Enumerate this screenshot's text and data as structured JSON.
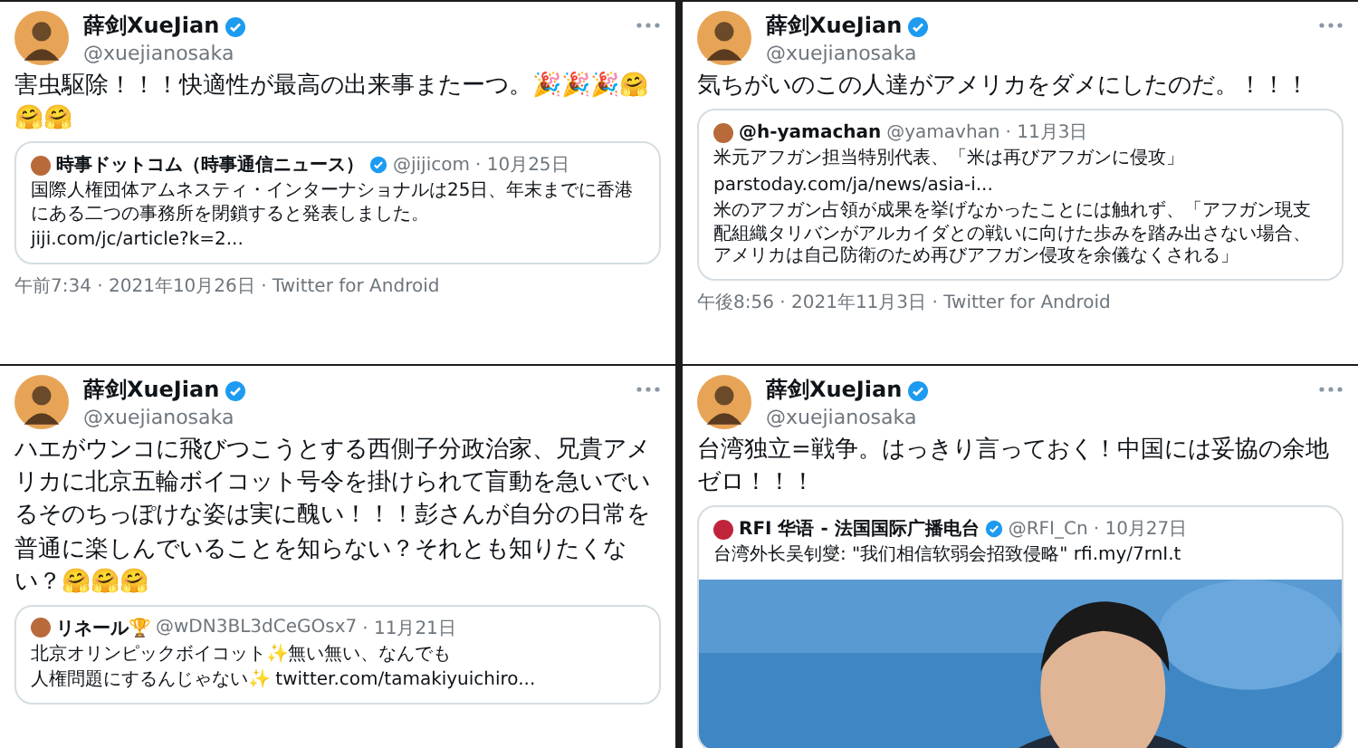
{
  "tweets": [
    {
      "name": "薛剑XueJian",
      "handle": "@xuejianosaka",
      "verified": true,
      "body": "害虫駆除！！！快適性が最高の出来事またーつ。🎉🎉🎉🤗🤗🤗",
      "quote": {
        "name": "時事ドットコム（時事通信ニュース）",
        "verified": true,
        "handle": "@jijicom",
        "date": "· 10月25日",
        "lines": [
          "国際人権団体アムネスティ・インターナショナルは25日、年末までに香港にある二つの事務所を閉鎖すると発表しました。",
          "jiji.com/jc/article?k=2..."
        ]
      },
      "footer": "午前7:34 · 2021年10月26日 · Twitter for Android"
    },
    {
      "name": "薛剑XueJian",
      "handle": "@xuejianosaka",
      "verified": true,
      "body": "気ちがいのこの人達がアメリカをダメにしたのだ。！！！",
      "quote": {
        "name": "@h-yamachan",
        "verified": false,
        "handle": "@yamavhan",
        "date": "· 11月3日",
        "lines": [
          "米元アフガン担当特別代表、「米は再びアフガンに侵攻」",
          "parstoday.com/ja/news/asia-i...",
          "米のアフガン占領が成果を挙げなかったことには触れず、「アフガン現支配組織タリバンがアルカイダとの戦いに向けた歩みを踏み出さない場合、アメリカは自己防衛のため再びアフガン侵攻を余儀なくされる」"
        ]
      },
      "footer": "午後8:56 · 2021年11月3日 · Twitter for Android"
    },
    {
      "name": "薛剑XueJian",
      "handle": "@xuejianosaka",
      "verified": true,
      "body": "ハエがウンコに飛びつこうとする西側子分政治家、兄貴アメリカに北京五輪ボイコット号令を掛けられて盲動を急いでいるそのちっぽけな姿は実に醜い！！！彭さんが自分の日常を普通に楽しんでいることを知らない？それとも知りたくない？🤗🤗🤗",
      "quote": {
        "name": "リネール🏆",
        "verified": false,
        "handle": "@wDN3BL3dCeGOsx7",
        "date": "· 11月21日",
        "lines": [
          "北京オリンピックボイコット✨無い無い、なんでも",
          "人権問題にするんじゃない✨ twitter.com/tamakiyuichiro..."
        ]
      }
    },
    {
      "name": "薛剑XueJian",
      "handle": "@xuejianosaka",
      "verified": true,
      "body": "台湾独立=戦争。はっきり言っておく！中国には妥協の余地ゼロ！！！",
      "quote": {
        "name": "RFI 华语 - 法国国际广播电台",
        "verified": true,
        "handle": "@RFI_Cn",
        "date": "· 10月27日",
        "lines": [
          "台湾外长吴钊燮: \"我们相信软弱会招致侵略\" rfi.my/7rnI.t"
        ],
        "media": {
          "kind": "picture"
        }
      }
    }
  ]
}
